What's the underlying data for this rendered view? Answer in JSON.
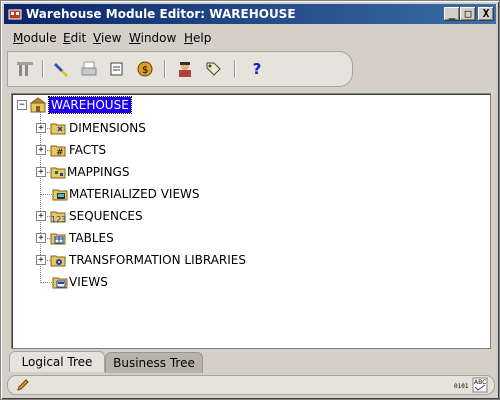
{
  "window": {
    "title": "Warehouse Module Editor: WAREHOUSE"
  },
  "title_buttons": {
    "minimize": "_",
    "maximize": "□",
    "close": "X"
  },
  "menu": [
    {
      "label": "Module",
      "mnemonic": "M",
      "rest": "odule"
    },
    {
      "label": "Edit",
      "mnemonic": "E",
      "rest": "dit"
    },
    {
      "label": "View",
      "mnemonic": "V",
      "rest": "iew"
    },
    {
      "label": "Window",
      "mnemonic": "W",
      "rest": "indow"
    },
    {
      "label": "Help",
      "mnemonic": "H",
      "rest": "elp"
    }
  ],
  "toolbar": {
    "icons": [
      "properties-icon",
      "flashlight-icon",
      "print-icon",
      "edit-icon",
      "configure-icon",
      "user-icon",
      "tag-icon",
      "help-icon"
    ],
    "help_glyph": "?"
  },
  "tree": {
    "root": "WAREHOUSE",
    "items": [
      {
        "label": "DIMENSIONS",
        "expandable": true
      },
      {
        "label": "FACTS",
        "expandable": true
      },
      {
        "label": "MAPPINGS",
        "expandable": true
      },
      {
        "label": "MATERIALIZED VIEWS",
        "expandable": false
      },
      {
        "label": "SEQUENCES",
        "expandable": true
      },
      {
        "label": "TABLES",
        "expandable": true
      },
      {
        "label": "TRANSFORMATION LIBRARIES",
        "expandable": true
      },
      {
        "label": "VIEWS",
        "expandable": false
      }
    ]
  },
  "tabs": [
    {
      "label": "Logical Tree",
      "active": true
    },
    {
      "label": "Business Tree",
      "active": false
    }
  ],
  "status": {
    "icons": [
      "pencil-icon",
      "binary-icon",
      "spellcheck-icon"
    ]
  },
  "colors": {
    "title_bar": "#0a246a",
    "selection": "#1d00f0",
    "folder": "#e8c860"
  }
}
